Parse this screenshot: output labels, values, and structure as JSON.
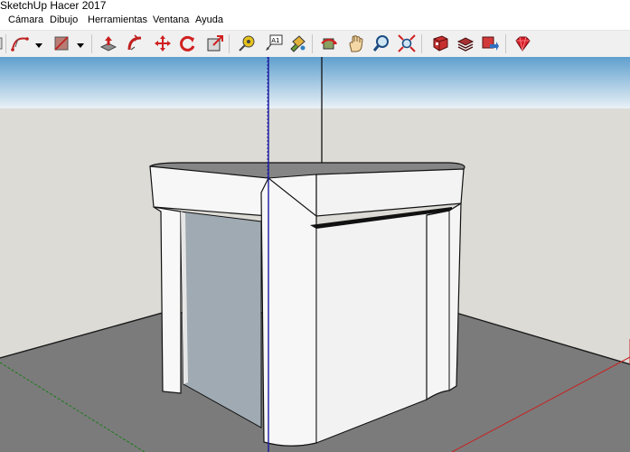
{
  "window": {
    "title": "SketchUp Hacer 2017"
  },
  "menu": {
    "items": [
      "Cámara",
      "Dibujo",
      "Herramientas",
      "Ventana",
      "Ayuda"
    ]
  },
  "toolbar": {
    "icons": [
      "arc-tool-icon",
      "paint-bucket-icon",
      "push-pull-icon",
      "follow-me-icon",
      "move-icon",
      "rotate-icon",
      "scale-icon",
      "tape-measure-icon",
      "text-label-icon",
      "paint-icon",
      "orbit-icon",
      "pan-icon",
      "zoom-icon",
      "zoom-extents-icon",
      "warehouse-icon",
      "extension-icon",
      "share-model-icon",
      "ruby-icon"
    ],
    "text_label_glyph": "A1"
  },
  "colors": {
    "sky_top": "#5f9fce",
    "sky_bottom": "#e9f1f6",
    "ground": "#dcdbd6",
    "plane": "#7b7b7b",
    "face_light": "#f5f5f5",
    "face_shadow": "#9faab2",
    "axis_blue": "#1a1aa0",
    "axis_red": "#c82020",
    "axis_green": "#1a7a1a"
  }
}
